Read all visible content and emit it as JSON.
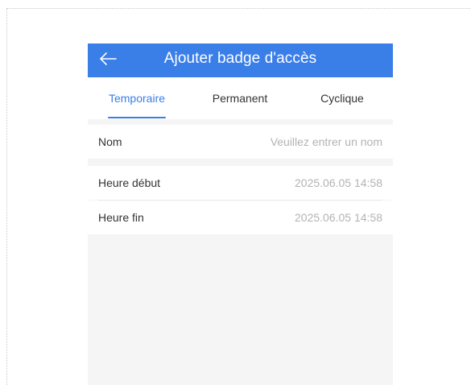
{
  "header": {
    "title": "Ajouter badge d'accès",
    "back_icon": "arrow-left-icon",
    "background_color": "#3a7ee8"
  },
  "tabs": [
    {
      "label": "Temporaire",
      "active": true
    },
    {
      "label": "Permanent",
      "active": false
    },
    {
      "label": "Cyclique",
      "active": false
    }
  ],
  "form": {
    "name": {
      "label": "Nom",
      "placeholder": "Veuillez entrer un nom"
    },
    "start": {
      "label": "Heure début",
      "value": "2025.06.05 14:58"
    },
    "end": {
      "label": "Heure fin",
      "value": "2025.06.05 14:58"
    }
  },
  "colors": {
    "accent": "#3a7ee8",
    "background": "#f5f5f5",
    "placeholder": "#b3b3b3"
  }
}
